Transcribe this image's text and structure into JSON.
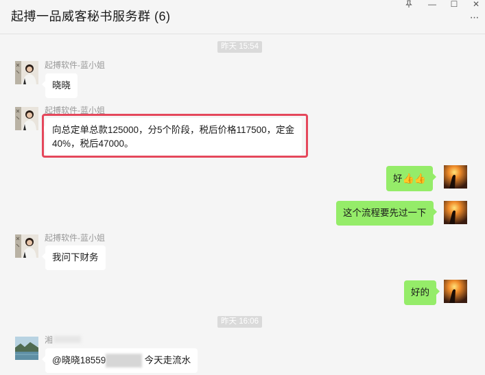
{
  "window": {
    "title": "起搏一品威客秘书服务群 (6)",
    "pin_icon": "pin-icon",
    "minimize_glyph": "—",
    "maximize_glyph": "☐",
    "close_glyph": "✕",
    "more_glyph": "···"
  },
  "timestamps": [
    "昨天 15:54",
    "昨天 16:06"
  ],
  "messages": [
    {
      "side": "left",
      "sender": "起搏软件-蓝小姐",
      "text": "晓晓"
    },
    {
      "side": "left",
      "sender": "起搏软件-蓝小姐",
      "text": "向总定单总款125000，分5个阶段，税后价格117500，定金40%，税后47000。"
    },
    {
      "side": "right",
      "text": "好",
      "emoji": "👍👍"
    },
    {
      "side": "right",
      "text": "这个流程要先过一下"
    },
    {
      "side": "left",
      "sender": "起搏软件-蓝小姐",
      "text": "我问下财务"
    },
    {
      "side": "right",
      "text": "好的"
    },
    {
      "side": "left",
      "sender_visible": "湘",
      "text_prefix": "@晓晓18559",
      "text_masked": "2277089",
      "text_suffix": " 今天走流水"
    }
  ],
  "colors": {
    "bubble_self": "#95ec69",
    "bubble_other": "#ffffff",
    "highlight": "#e5475b",
    "background": "#f5f5f5"
  }
}
